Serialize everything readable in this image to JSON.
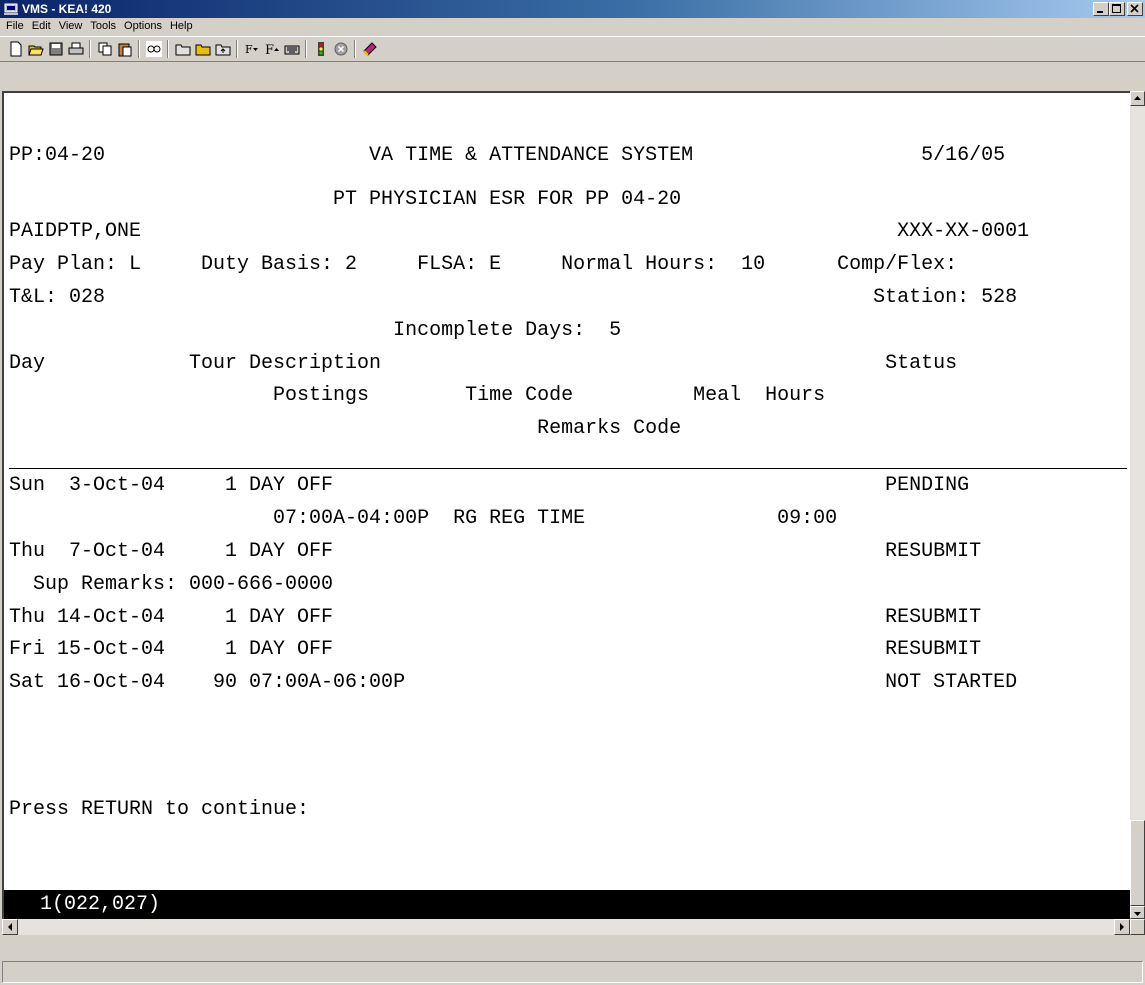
{
  "window": {
    "title": "VMS - KEA! 420",
    "controls": [
      "minimize",
      "maximize",
      "close"
    ]
  },
  "menu": [
    "File",
    "Edit",
    "View",
    "Tools",
    "Options",
    "Help"
  ],
  "toolbar_icons": [
    "new-icon",
    "open-icon",
    "save-icon",
    "print-icon",
    "copy-icon",
    "paste-icon",
    "connect-icon",
    "folder-icon",
    "folder-open-icon",
    "folder-up-icon",
    "font-down-icon",
    "font-up-icon",
    "keyboard-icon",
    "traffic-light-icon",
    "stop-icon",
    "book-icon"
  ],
  "terminal": {
    "lines": [
      "PP:04-20                      VA TIME & ATTENDANCE SYSTEM                   5/16/05",
      "                           PT PHYSICIAN ESR FOR PP 04-20",
      "PAIDPTP,ONE                                                               XXX-XX-0001",
      "Pay Plan: L     Duty Basis: 2     FLSA: E     Normal Hours:  10      Comp/Flex:",
      "T&L: 028                                                                Station: 528",
      "                                Incomplete Days:  5",
      "Day            Tour Description                                          Status",
      "                      Postings        Time Code          Meal  Hours",
      "                                            Remarks Code",
      "Sun  3-Oct-04     1 DAY OFF                                              PENDING",
      "                      07:00A-04:00P  RG REG TIME                09:00",
      "Thu  7-Oct-04     1 DAY OFF                                              RESUBMIT",
      "  Sup Remarks: 000-666-0000",
      "Thu 14-Oct-04     1 DAY OFF                                              RESUBMIT",
      "Fri 15-Oct-04     1 DAY OFF                                              RESUBMIT",
      "Sat 16-Oct-04    90 07:00A-06:00P                                        NOT STARTED",
      "Press RETURN to continue:"
    ],
    "status_line": "   1(022,027)"
  }
}
